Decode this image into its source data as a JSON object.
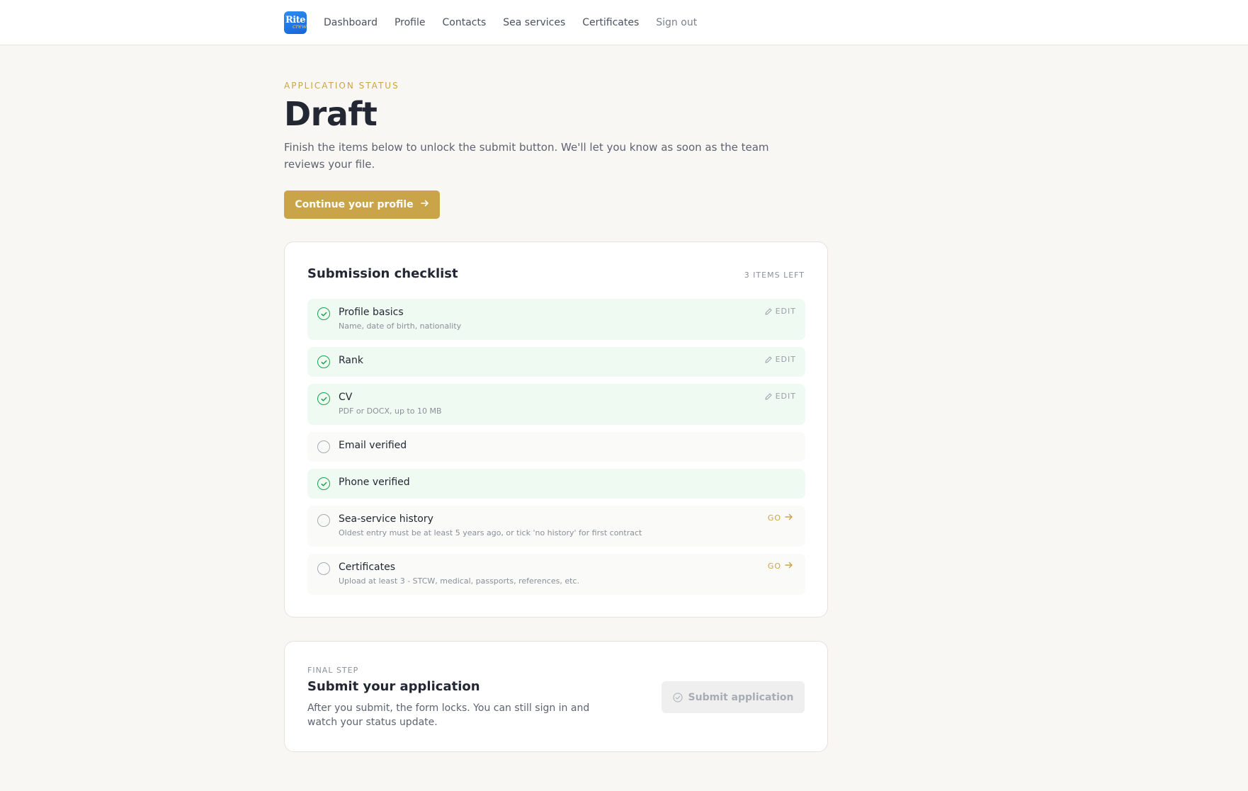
{
  "nav": {
    "logo_text": "Rite",
    "logo_subtext": "crew",
    "items": [
      {
        "label": "Dashboard"
      },
      {
        "label": "Profile"
      },
      {
        "label": "Contacts"
      },
      {
        "label": "Sea services"
      },
      {
        "label": "Certificates"
      },
      {
        "label": "Sign out"
      }
    ]
  },
  "header": {
    "eyebrow": "APPLICATION STATUS",
    "title": "Draft",
    "lead": "Finish the items below to unlock the submit button. We'll let you know as soon as the team reviews your file.",
    "cta_label": "Continue your profile",
    "cta_icon": "arrow-right-icon"
  },
  "checklist": {
    "title": "Submission checklist",
    "items_left": "3 ITEMS LEFT",
    "items": [
      {
        "label": "Profile basics",
        "sub": "Name, date of birth, nationality",
        "done": true,
        "action": "EDIT"
      },
      {
        "label": "Rank",
        "sub": "",
        "done": true,
        "action": "EDIT"
      },
      {
        "label": "CV",
        "sub": "PDF or DOCX, up to 10 MB",
        "done": true,
        "action": "EDIT"
      },
      {
        "label": "Email verified",
        "sub": "",
        "done": false,
        "action": ""
      },
      {
        "label": "Phone verified",
        "sub": "",
        "done": true,
        "action": ""
      },
      {
        "label": "Sea-service history",
        "sub": "Oldest entry must be at least 5 years ago, or tick 'no history' for first contract",
        "done": false,
        "action": "GO"
      },
      {
        "label": "Certificates",
        "sub": "Upload at least 3 - STCW, medical, passports, references, etc.",
        "done": false,
        "action": "GO"
      }
    ]
  },
  "final": {
    "eyebrow": "FINAL STEP",
    "title": "Submit your application",
    "description": "After you submit, the form locks. You can still sign in and watch your status update.",
    "submit_label": "Submit application",
    "submit_disabled": true
  },
  "colors": {
    "accent": "#c9a448",
    "done_bg": "#effbf2",
    "done_icon": "#14a44d",
    "page_bg": "#f8f7f4"
  }
}
